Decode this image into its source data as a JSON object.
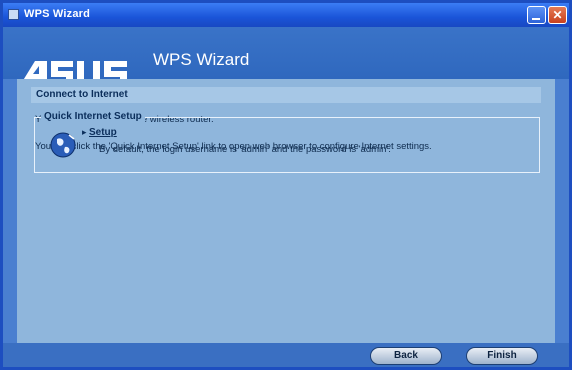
{
  "window": {
    "title": "WPS Wizard"
  },
  "header": {
    "brand": "ASUS",
    "title": "WPS Wizard"
  },
  "section": {
    "title": "Connect to Internet",
    "message1": "You have connected to the wireless router.",
    "message2": "You can click the 'Quick Internet Setup' link to open web browser to configure Internet settings."
  },
  "quick_setup": {
    "legend": "Quick Internet Setup",
    "link": "Setup",
    "description": "By default, the login username is 'admin' and the password is 'admin'."
  },
  "buttons": {
    "back": "Back",
    "finish": "Finish"
  },
  "colors": {
    "titlebar": "#1a54d8",
    "panel": "#8fb6dc",
    "header": "#3a73c8"
  }
}
